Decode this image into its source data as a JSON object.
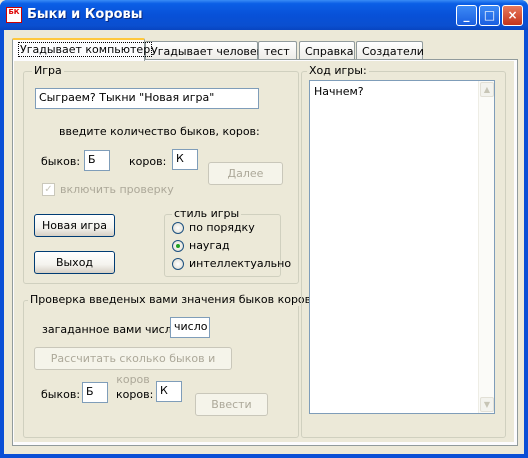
{
  "window": {
    "title": "Быки и Коровы",
    "icon_text": "БК",
    "controls": {
      "minimize": "_",
      "maximize": "□",
      "close": "×"
    }
  },
  "tabs": [
    {
      "label": "Угадывает компьютер",
      "active": true
    },
    {
      "label": "Угадывает человек"
    },
    {
      "label": "тест"
    },
    {
      "label": "Справка"
    },
    {
      "label": "Создатели"
    }
  ],
  "game_group": {
    "legend": "Игра",
    "message": "Сыграем? Тыкни \"Новая игра\"",
    "prompt": "введите количество быков, коров:",
    "bulls_label": "быков:",
    "bulls_value": "Б",
    "cows_label": "коров:",
    "cows_value": "К",
    "next_button": "Далее",
    "check_label": "включить проверку",
    "check_mark": "✓",
    "new_game_button": "Новая игра",
    "exit_button": "Выход",
    "style_group": {
      "legend": "стиль игры",
      "options": [
        {
          "label": "по порядку",
          "selected": false
        },
        {
          "label": "наугад",
          "selected": true
        },
        {
          "label": "интеллектуально",
          "selected": false
        }
      ]
    }
  },
  "verify_group": {
    "legend": "Проверка введеных вами значения быков коров",
    "number_label": "загаданное вами число:",
    "number_value": "число",
    "calc_button": "Рассчитать сколько быков и коров",
    "bulls_label": "быков:",
    "bulls_value": "Б",
    "cows_label": "коров:",
    "cows_value": "К",
    "enter_button": "Ввести"
  },
  "log_group": {
    "legend": "Ход игры:",
    "text": "Начнем?",
    "scroll_up": "▲",
    "scroll_down": "▼"
  }
}
